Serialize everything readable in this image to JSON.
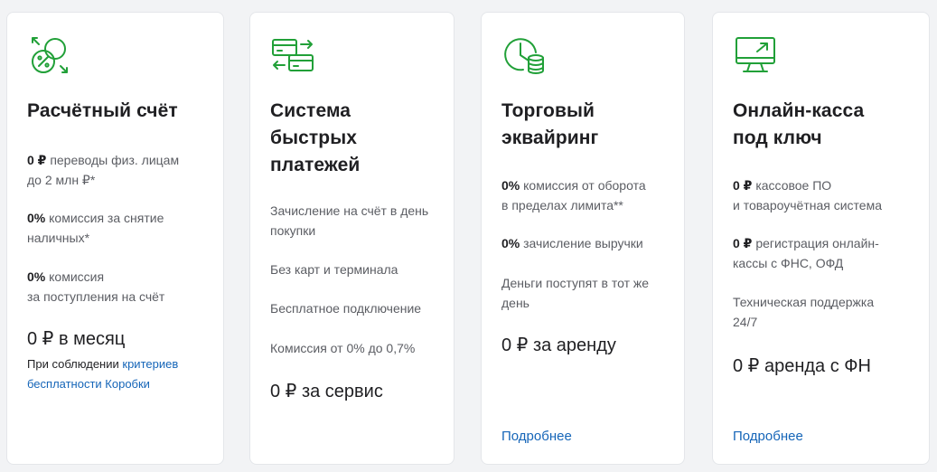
{
  "colors": {
    "accent": "#21a038",
    "link": "#1565b8",
    "text": "#1f1f22",
    "muted": "#5b5d63"
  },
  "cards": [
    {
      "icon": "percent-coins-exchange-icon",
      "title_lines": [
        "Расчётный счёт"
      ],
      "features": [
        {
          "bold": "0 ₽",
          "text_lines": [
            "переводы физ. лицам",
            "до 2 млн ₽*"
          ]
        },
        {
          "bold": "0%",
          "text_lines": [
            "комиссия за снятие",
            "наличных*"
          ]
        },
        {
          "bold": "0%",
          "text_lines": [
            "комиссия",
            "за поступления на счёт"
          ]
        }
      ],
      "price": "0 ₽ в месяц",
      "note": {
        "prefix": "При соблюдении",
        "link_line1": "критериев",
        "link_line2": "бесплатности Коробки"
      }
    },
    {
      "icon": "cards-transfer-icon",
      "title_lines": [
        "Система",
        "быстрых",
        "платежей"
      ],
      "features": [
        {
          "text_lines": [
            "Зачисление на счёт в день",
            "покупки"
          ]
        },
        {
          "text_lines": [
            "Без карт и терминала"
          ]
        },
        {
          "text_lines": [
            "Бесплатное подключение"
          ]
        },
        {
          "text_lines": [
            "Комиссия от 0% до 0,7%"
          ]
        }
      ],
      "price": "0 ₽ за сервис"
    },
    {
      "icon": "clock-coins-icon",
      "title_lines": [
        "Торговый",
        "эквайринг"
      ],
      "features": [
        {
          "bold": "0%",
          "text_lines": [
            "комиссия от оборота",
            "в пределах лимита**"
          ]
        },
        {
          "bold": "0%",
          "text_lines": [
            "зачисление выручки"
          ]
        },
        {
          "text_lines": [
            "Деньги поступят в тот же",
            "день"
          ]
        }
      ],
      "price": "0 ₽ за аренду",
      "more_link": "Подробнее"
    },
    {
      "icon": "monitor-arrow-icon",
      "title_lines": [
        "Онлайн-касса",
        "под ключ"
      ],
      "features": [
        {
          "bold": "0 ₽",
          "text_lines": [
            "кассовое ПО",
            "и товароучётная система"
          ]
        },
        {
          "bold": "0 ₽",
          "text_lines": [
            "регистрация онлайн-",
            "кассы с ФНС, ОФД"
          ]
        },
        {
          "text_lines": [
            "Техническая поддержка",
            "24/7"
          ]
        }
      ],
      "price": "0 ₽ аренда с ФН",
      "more_link": "Подробнее"
    }
  ]
}
